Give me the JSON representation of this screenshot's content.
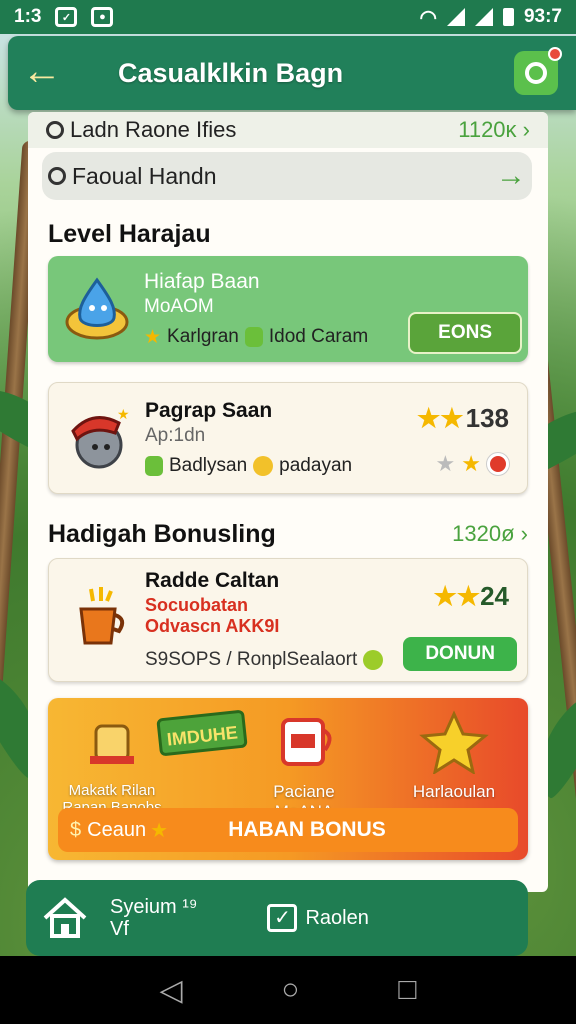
{
  "status": {
    "time": "1:3",
    "clock": "93:7"
  },
  "appbar": {
    "title": "Casualklkin Bagn"
  },
  "top": {
    "row1_label": "Ladn Raone Ifies",
    "row1_value": "1120ĸ",
    "row2_label": "Faoual Handn"
  },
  "section1": {
    "title": "Level Harajau"
  },
  "card1": {
    "title": "Hiafap Baan",
    "sub": "MoAOM",
    "meta1": "Karlgran",
    "meta2": "Idod Caram",
    "button": "EONS"
  },
  "card2": {
    "title": "Pagrap Saan",
    "sub": "Ap:1dn",
    "meta1": "Badlysan",
    "meta2": "padayan",
    "stat": "138"
  },
  "section2": {
    "title": "Hadigah Bonusling",
    "value": "1320ø"
  },
  "card3": {
    "title": "Radde Caltan",
    "sub1": "Socuobatan",
    "sub2": "Odvascn AKK9I",
    "meta": "S9SOPS / RonplSealaort",
    "stat": "24",
    "button": "DONUN"
  },
  "banner": {
    "items": [
      {
        "label": "Makatk Rilan\nRapan Banobs"
      },
      {
        "label": "Paciane MaANA"
      },
      {
        "label": "Harlaoulan"
      }
    ],
    "badge": "IMDUHE",
    "bar_left": "Ceaun",
    "bar_label": "HABAN BONUS"
  },
  "nav": {
    "item1": "Syeium ¹⁹",
    "item1_sub": "Vf",
    "item2": "Raolen"
  },
  "colors": {
    "primary": "#21805a",
    "accent": "#5aa43a",
    "banner_start": "#f7b733",
    "banner_end": "#e84a2a"
  }
}
